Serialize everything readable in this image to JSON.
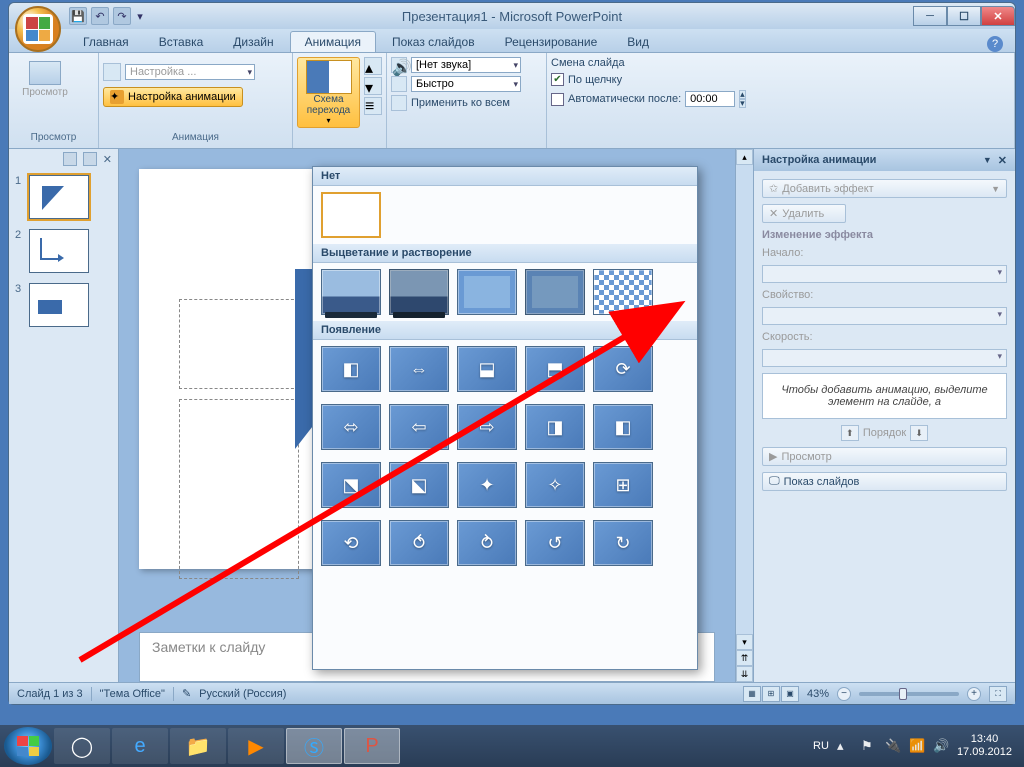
{
  "window": {
    "title": "Презентация1 - Microsoft PowerPoint"
  },
  "tabs": {
    "home": "Главная",
    "insert": "Вставка",
    "design": "Дизайн",
    "animation": "Анимация",
    "slideshow": "Показ слайдов",
    "review": "Рецензирование",
    "view": "Вид"
  },
  "ribbon": {
    "preview_group": "Просмотр",
    "preview_btn": "Просмотр",
    "animation_group": "Анимация",
    "custom_dd": "Настройка ...",
    "custom_btn": "Настройка анимации",
    "transition_label": "Схема перехода",
    "sound_label": "[Нет звука]",
    "speed_label": "Быстро",
    "apply_all": "Применить ко всем",
    "advance_header": "Смена слайда",
    "on_click": "По щелчку",
    "auto_after": "Автоматически после:",
    "auto_time": "00:00"
  },
  "gallery": {
    "none": "Нет",
    "fade": "Выцветание и растворение",
    "appear": "Появление"
  },
  "pane": {
    "title": "Настройка анимации",
    "add_effect": "Добавить эффект",
    "remove": "Удалить",
    "modify": "Изменение эффекта",
    "start": "Начало:",
    "property": "Свойство:",
    "speed": "Скорость:",
    "help_text": "Чтобы добавить анимацию, выделите элемент на слайде, а",
    "reorder": "Порядок",
    "play": "Просмотр",
    "slideshow": "Показ слайдов"
  },
  "notes": {
    "placeholder": "Заметки к слайду"
  },
  "status": {
    "slide_info": "Слайд 1 из 3",
    "theme": "\"Тема Office\"",
    "language": "Русский (Россия)",
    "zoom": "43%"
  },
  "slides": [
    {
      "num": "1"
    },
    {
      "num": "2"
    },
    {
      "num": "3"
    }
  ],
  "tray": {
    "lang": "RU",
    "time": "13:40",
    "date": "17.09.2012"
  }
}
